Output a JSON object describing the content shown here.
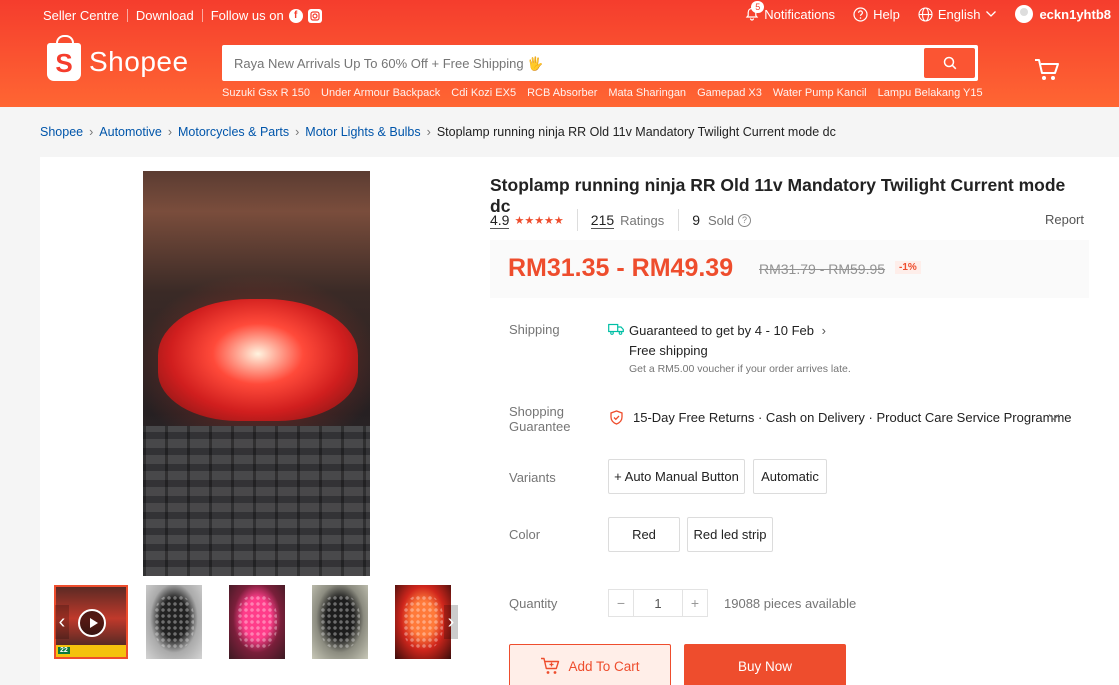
{
  "topbar": {
    "seller_centre": "Seller Centre",
    "download": "Download",
    "follow_us": "Follow us on",
    "notifications": "Notifications",
    "notification_count": "5",
    "help": "Help",
    "language": "English",
    "username": "eckn1yhtb8"
  },
  "brand": {
    "name": "Shopee",
    "logo_letter": "S"
  },
  "search": {
    "placeholder": "Raya New Arrivals Up To 60% Off + Free Shipping 🖐",
    "suggestions": [
      "Suzuki Gsx R 150",
      "Under Armour Backpack",
      "Cdi Kozi EX5",
      "RCB Absorber",
      "Mata Sharingan",
      "Gamepad X3",
      "Water Pump Kancil",
      "Lampu Belakang Y15"
    ]
  },
  "breadcrumb": [
    "Shopee",
    "Automotive",
    "Motorcycles & Parts",
    "Motor Lights & Bulbs",
    "Stoplamp running ninja RR Old 11v Mandatory Twilight Current mode dc"
  ],
  "product": {
    "title": "Stoplamp running ninja RR Old 11v Mandatory Twilight Current mode dc",
    "rating": "4.9",
    "stars": "★★★★★",
    "ratings_count": "215",
    "ratings_label": "Ratings",
    "sold_count": "9",
    "sold_label": "Sold",
    "report": "Report",
    "price": "RM31.35 - RM49.39",
    "old_price": "RM31.79 - RM59.95",
    "discount": "-1%"
  },
  "shipping": {
    "label": "Shipping",
    "guarantee_text": "Guaranteed to get by 4 - 10 Feb",
    "free": "Free shipping",
    "note": "Get a RM5.00 voucher if your order arrives late."
  },
  "guarantee": {
    "label_line1": "Shopping",
    "label_line2": "Guarantee",
    "text": "15-Day Free Returns · Cash on Delivery · Product Care Service Programme"
  },
  "variants": {
    "label": "Variants",
    "options": [
      "+ Auto Manual Button",
      "Automatic"
    ]
  },
  "color": {
    "label": "Color",
    "options": [
      "Red",
      "Red led strip"
    ]
  },
  "quantity": {
    "label": "Quantity",
    "value": "1",
    "available": "19088 pieces available"
  },
  "actions": {
    "add_to_cart": "Add To Cart",
    "buy_now": "Buy Now"
  },
  "thumbnail_badge": "22"
}
